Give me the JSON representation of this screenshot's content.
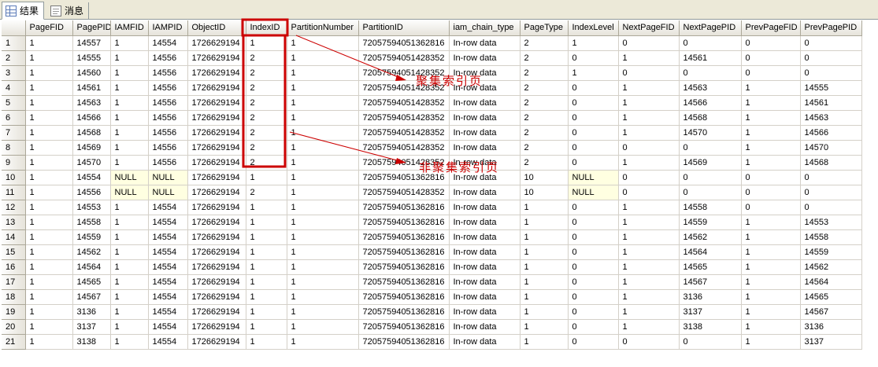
{
  "tabs": [
    {
      "label": "结果",
      "icon": "grid-icon",
      "active": true
    },
    {
      "label": "消息",
      "icon": "message-icon",
      "active": false
    }
  ],
  "columns": [
    "PageFID",
    "PagePID",
    "IAMFID",
    "IAMPID",
    "ObjectID",
    "IndexID",
    "PartitionNumber",
    "PartitionID",
    "iam_chain_type",
    "PageType",
    "IndexLevel",
    "NextPageFID",
    "NextPagePID",
    "PrevPageFID",
    "PrevPagePID"
  ],
  "rows": [
    [
      "1",
      "14557",
      "1",
      "14554",
      "1726629194",
      "1",
      "1",
      "72057594051362816",
      "In-row data",
      "2",
      "1",
      "0",
      "0",
      "0",
      "0"
    ],
    [
      "1",
      "14555",
      "1",
      "14556",
      "1726629194",
      "2",
      "1",
      "72057594051428352",
      "In-row data",
      "2",
      "0",
      "1",
      "14561",
      "0",
      "0"
    ],
    [
      "1",
      "14560",
      "1",
      "14556",
      "1726629194",
      "2",
      "1",
      "72057594051428352",
      "In-row data",
      "2",
      "1",
      "0",
      "0",
      "0",
      "0"
    ],
    [
      "1",
      "14561",
      "1",
      "14556",
      "1726629194",
      "2",
      "1",
      "72057594051428352",
      "In-row data",
      "2",
      "0",
      "1",
      "14563",
      "1",
      "14555"
    ],
    [
      "1",
      "14563",
      "1",
      "14556",
      "1726629194",
      "2",
      "1",
      "72057594051428352",
      "In-row data",
      "2",
      "0",
      "1",
      "14566",
      "1",
      "14561"
    ],
    [
      "1",
      "14566",
      "1",
      "14556",
      "1726629194",
      "2",
      "1",
      "72057594051428352",
      "In-row data",
      "2",
      "0",
      "1",
      "14568",
      "1",
      "14563"
    ],
    [
      "1",
      "14568",
      "1",
      "14556",
      "1726629194",
      "2",
      "1",
      "72057594051428352",
      "In-row data",
      "2",
      "0",
      "1",
      "14570",
      "1",
      "14566"
    ],
    [
      "1",
      "14569",
      "1",
      "14556",
      "1726629194",
      "2",
      "1",
      "72057594051428352",
      "In-row data",
      "2",
      "0",
      "0",
      "0",
      "1",
      "14570"
    ],
    [
      "1",
      "14570",
      "1",
      "14556",
      "1726629194",
      "2",
      "1",
      "72057594051428352",
      "In-row data",
      "2",
      "0",
      "1",
      "14569",
      "1",
      "14568"
    ],
    [
      "1",
      "14554",
      "NULL",
      "NULL",
      "1726629194",
      "1",
      "1",
      "72057594051362816",
      "In-row data",
      "10",
      "NULL",
      "0",
      "0",
      "0",
      "0"
    ],
    [
      "1",
      "14556",
      "NULL",
      "NULL",
      "1726629194",
      "2",
      "1",
      "72057594051428352",
      "In-row data",
      "10",
      "NULL",
      "0",
      "0",
      "0",
      "0"
    ],
    [
      "1",
      "14553",
      "1",
      "14554",
      "1726629194",
      "1",
      "1",
      "72057594051362816",
      "In-row data",
      "1",
      "0",
      "1",
      "14558",
      "0",
      "0"
    ],
    [
      "1",
      "14558",
      "1",
      "14554",
      "1726629194",
      "1",
      "1",
      "72057594051362816",
      "In-row data",
      "1",
      "0",
      "1",
      "14559",
      "1",
      "14553"
    ],
    [
      "1",
      "14559",
      "1",
      "14554",
      "1726629194",
      "1",
      "1",
      "72057594051362816",
      "In-row data",
      "1",
      "0",
      "1",
      "14562",
      "1",
      "14558"
    ],
    [
      "1",
      "14562",
      "1",
      "14554",
      "1726629194",
      "1",
      "1",
      "72057594051362816",
      "In-row data",
      "1",
      "0",
      "1",
      "14564",
      "1",
      "14559"
    ],
    [
      "1",
      "14564",
      "1",
      "14554",
      "1726629194",
      "1",
      "1",
      "72057594051362816",
      "In-row data",
      "1",
      "0",
      "1",
      "14565",
      "1",
      "14562"
    ],
    [
      "1",
      "14565",
      "1",
      "14554",
      "1726629194",
      "1",
      "1",
      "72057594051362816",
      "In-row data",
      "1",
      "0",
      "1",
      "14567",
      "1",
      "14564"
    ],
    [
      "1",
      "14567",
      "1",
      "14554",
      "1726629194",
      "1",
      "1",
      "72057594051362816",
      "In-row data",
      "1",
      "0",
      "1",
      "3136",
      "1",
      "14565"
    ],
    [
      "1",
      "3136",
      "1",
      "14554",
      "1726629194",
      "1",
      "1",
      "72057594051362816",
      "In-row data",
      "1",
      "0",
      "1",
      "3137",
      "1",
      "14567"
    ],
    [
      "1",
      "3137",
      "1",
      "14554",
      "1726629194",
      "1",
      "1",
      "72057594051362816",
      "In-row data",
      "1",
      "0",
      "1",
      "3138",
      "1",
      "3136"
    ],
    [
      "1",
      "3138",
      "1",
      "14554",
      "1726629194",
      "1",
      "1",
      "72057594051362816",
      "In-row data",
      "1",
      "0",
      "0",
      "0",
      "1",
      "3137"
    ]
  ],
  "annotations": {
    "clustered_label": "聚集索引页",
    "nonclustered_label": "非聚集索引页",
    "color": "#cc0000"
  }
}
